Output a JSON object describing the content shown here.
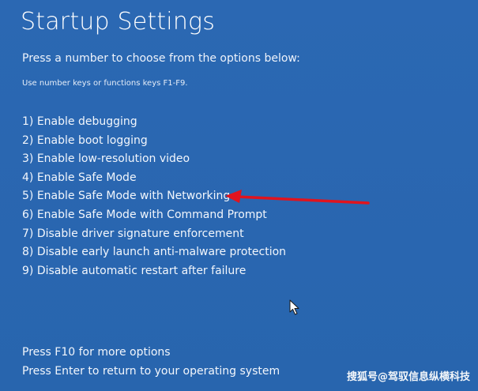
{
  "screen": {
    "title": "Startup Settings",
    "prompt": "Press a number to choose from the options below:",
    "hint": "Use number keys or functions keys F1-F9."
  },
  "options": [
    {
      "label": "1) Enable debugging"
    },
    {
      "label": "2) Enable boot logging"
    },
    {
      "label": "3) Enable low-resolution video"
    },
    {
      "label": "4) Enable Safe Mode"
    },
    {
      "label": "5) Enable Safe Mode with Networking"
    },
    {
      "label": "6) Enable Safe Mode with Command Prompt"
    },
    {
      "label": "7) Disable driver signature enforcement"
    },
    {
      "label": "8) Disable early launch anti-malware protection"
    },
    {
      "label": "9) Disable automatic restart after failure"
    }
  ],
  "footer": {
    "more_options": "Press F10 for more options",
    "return": "Press Enter to return to your operating system"
  },
  "watermark": {
    "text": "搜狐号@驾驭信息纵横科技"
  },
  "colors": {
    "background": "#2a67b1",
    "text": "#ffffff",
    "arrow": "#e0141e"
  },
  "icons": {
    "arrow": "red-arrow-icon",
    "cursor": "mouse-pointer-icon"
  }
}
